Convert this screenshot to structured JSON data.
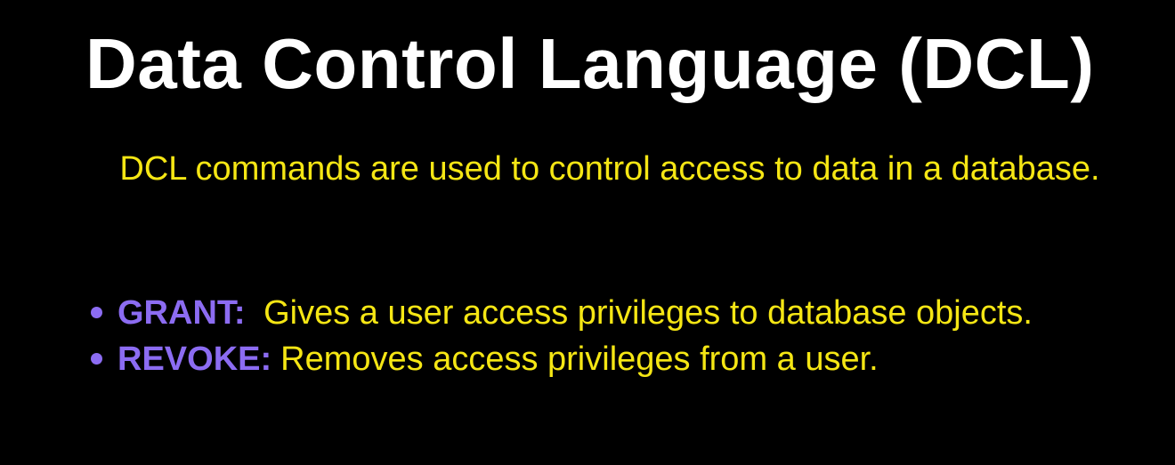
{
  "slide": {
    "title": "Data Control Language (DCL)",
    "description": "DCL commands are used to control access to data in a database.",
    "bullets": [
      {
        "term": "GRANT:",
        "text": " Gives a user access privileges to database objects."
      },
      {
        "term": "REVOKE:",
        "text": "Removes access privileges from a user."
      }
    ]
  },
  "colors": {
    "background": "#000000",
    "title": "#ffffff",
    "body_text": "#f5e614",
    "keyword": "#8c6cf2"
  },
  "icons": {
    "bullet": "bullet-dot-icon"
  }
}
